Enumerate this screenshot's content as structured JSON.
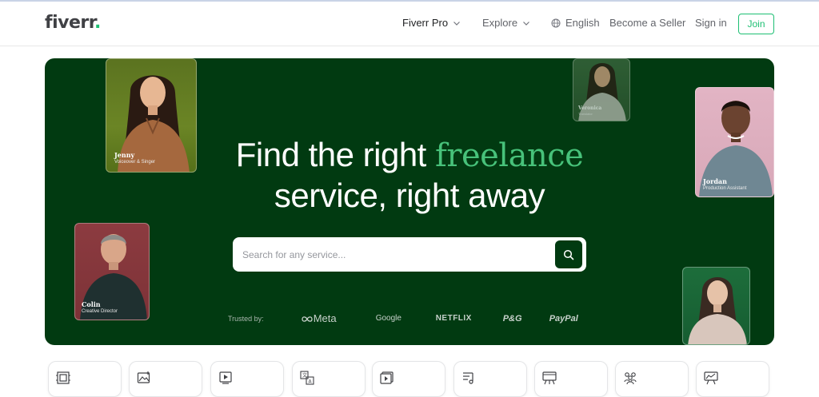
{
  "header": {
    "logo": "fiverr",
    "logo_dot": ".",
    "nav_pro": "Fiverr Pro",
    "nav_explore": "Explore",
    "nav_language": "English",
    "nav_seller": "Become a Seller",
    "nav_signin": "Sign in",
    "join": "Join"
  },
  "hero": {
    "title_part1": "Find the right ",
    "title_accent": "freelance",
    "title_line2": "service, right away",
    "search_placeholder": "Search for any service...",
    "trusted_label": "Trusted by:",
    "brands": [
      "Meta",
      "Google",
      "NETFLIX",
      "P&G",
      "PayPal"
    ]
  },
  "cards": {
    "jenny": {
      "name": "Jenny",
      "role": "Voiceover & Singer"
    },
    "colin": {
      "name": "Colin",
      "role": "Creative Director"
    },
    "veronica": {
      "name": "Veronica",
      "role": "Translator"
    },
    "jordan": {
      "name": "Jordan",
      "role": "Production Assistant"
    }
  },
  "categories": [
    {
      "icon": "programming-icon"
    },
    {
      "icon": "graphics-design-icon"
    },
    {
      "icon": "digital-marketing-icon"
    },
    {
      "icon": "writing-translation-icon"
    },
    {
      "icon": "video-animation-icon"
    },
    {
      "icon": "music-audio-icon"
    },
    {
      "icon": "business-icon"
    },
    {
      "icon": "consulting-icon"
    },
    {
      "icon": "data-icon"
    }
  ],
  "colors": {
    "brand_green": "#1dbf73",
    "hero_bg": "#013a11",
    "accent_text": "#47c27a"
  }
}
